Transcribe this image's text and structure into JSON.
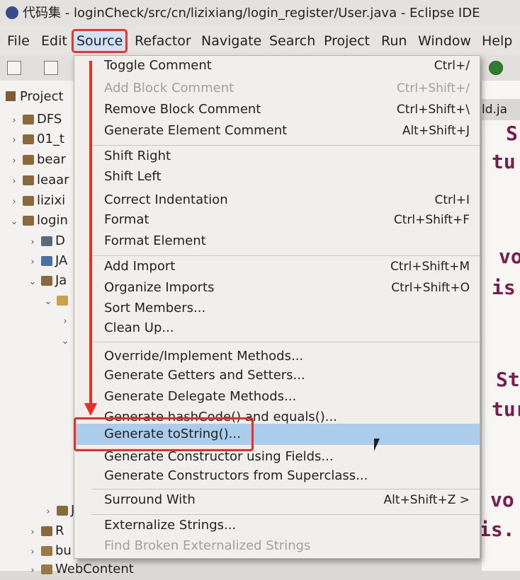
{
  "window": {
    "title": "代码集 - loginCheck/src/cn/lizixiang/login_register/User.java - Eclipse IDE"
  },
  "menubar": [
    "File",
    "Edit",
    "Source",
    "Refactor",
    "Navigate",
    "Search",
    "Project",
    "Run",
    "Window",
    "Help"
  ],
  "project_panel": {
    "tab_label": "Project",
    "rows": [
      "DFS",
      "01_t",
      "bear",
      "leaar",
      "lizixi",
      "login",
      "D",
      "JA",
      "Ja",
      "",
      "",
      "",
      "Ja",
      "R",
      "bu",
      "WebContent"
    ]
  },
  "editor": {
    "tab_label": "ld.ja",
    "code_fragments": [
      "S",
      "tu",
      "vo",
      "is.",
      "St",
      "tur",
      "vo",
      "is."
    ]
  },
  "source_menu": {
    "items": [
      {
        "label": "Toggle Comment",
        "shortcut": "Ctrl+/"
      },
      {
        "label": "Add Block Comment",
        "shortcut": "Ctrl+Shift+/"
      },
      {
        "label": "Remove Block Comment",
        "shortcut": "Ctrl+Shift+\\"
      },
      {
        "label": "Generate Element Comment",
        "shortcut": "Alt+Shift+J"
      },
      {
        "label": "Shift Right",
        "shortcut": ""
      },
      {
        "label": "Shift Left",
        "shortcut": ""
      },
      {
        "label": "Correct Indentation",
        "shortcut": "Ctrl+I"
      },
      {
        "label": "Format",
        "shortcut": "Ctrl+Shift+F"
      },
      {
        "label": "Format Element",
        "shortcut": ""
      },
      {
        "label": "Add Import",
        "shortcut": "Ctrl+Shift+M"
      },
      {
        "label": "Organize Imports",
        "shortcut": "Ctrl+Shift+O"
      },
      {
        "label": "Sort Members...",
        "shortcut": ""
      },
      {
        "label": "Clean Up...",
        "shortcut": ""
      },
      {
        "label": "Override/Implement Methods...",
        "shortcut": ""
      },
      {
        "label": "Generate Getters and Setters...",
        "shortcut": ""
      },
      {
        "label": "Generate Delegate Methods...",
        "shortcut": ""
      },
      {
        "label": "Generate hashCode() and equals()...",
        "shortcut": ""
      },
      {
        "label": "Generate toString()...",
        "shortcut": ""
      },
      {
        "label": "Generate Constructor using Fields...",
        "shortcut": ""
      },
      {
        "label": "Generate Constructors from Superclass...",
        "shortcut": ""
      },
      {
        "label": "Surround With",
        "shortcut": "Alt+Shift+Z >"
      },
      {
        "label": "Externalize Strings...",
        "shortcut": ""
      },
      {
        "label": "Find Broken Externalized Strings",
        "shortcut": ""
      }
    ]
  },
  "colors": {
    "highlight": "#a9cdeb",
    "annotation_red": "#ee2b24",
    "menu_bg": "#f1efec"
  }
}
